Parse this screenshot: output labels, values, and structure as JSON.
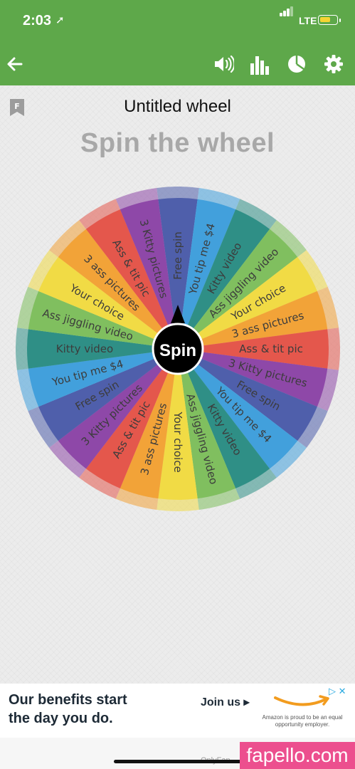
{
  "status": {
    "time": "2:03",
    "network": "LTE"
  },
  "toolbar": {
    "back_icon": "arrow-left-icon",
    "sound_icon": "volume-icon",
    "stats_icon": "bar-chart-icon",
    "pie_icon": "pie-chart-icon",
    "settings_icon": "gear-icon"
  },
  "wheel": {
    "title": "Untitled wheel",
    "heading": "Spin the wheel",
    "spin_label": "Spin",
    "slices": [
      {
        "label": "Free spin",
        "color": "#4f5fab"
      },
      {
        "label": "You tip me $4",
        "color": "#42a0dc"
      },
      {
        "label": "Kitty video",
        "color": "#2f8f86"
      },
      {
        "label": "Ass jiggling video",
        "color": "#80bf5f"
      },
      {
        "label": "Your choice",
        "color": "#f1db45"
      },
      {
        "label": "3 ass pictures",
        "color": "#f2a338"
      },
      {
        "label": "Ass & tit pic",
        "color": "#e4574c"
      },
      {
        "label": "3 Kitty pictures",
        "color": "#8e48a8"
      },
      {
        "label": "Free spin",
        "color": "#4f5fab"
      },
      {
        "label": "You tip me $4",
        "color": "#42a0dc"
      },
      {
        "label": "Kitty video",
        "color": "#2f8f86"
      },
      {
        "label": "Ass jiggling video",
        "color": "#80bf5f"
      },
      {
        "label": "Your choice",
        "color": "#f1db45"
      },
      {
        "label": "3 ass pictures",
        "color": "#f2a338"
      },
      {
        "label": "Ass & tit pic",
        "color": "#e4574c"
      },
      {
        "label": "3 Kitty pictures",
        "color": "#8e48a8"
      },
      {
        "label": "Free spin",
        "color": "#4f5fab"
      },
      {
        "label": "You tip me $4",
        "color": "#42a0dc"
      },
      {
        "label": "Kitty video",
        "color": "#2f8f86"
      },
      {
        "label": "Ass jiggling video",
        "color": "#80bf5f"
      },
      {
        "label": "Your choice",
        "color": "#f1db45"
      },
      {
        "label": "3 ass pictures",
        "color": "#f2a338"
      },
      {
        "label": "Ass & tit pic",
        "color": "#e4574c"
      },
      {
        "label": "3 Kitty pictures",
        "color": "#8e48a8"
      }
    ]
  },
  "ad": {
    "headline_1": "Our benefits start",
    "headline_2": "the day you do.",
    "cta": "Join us ▸",
    "disclaimer": "Amazon is proud to be an equal opportunity employer."
  },
  "footer": {
    "watermark": "fapello.com",
    "bottom_text": "OnlyFan"
  }
}
